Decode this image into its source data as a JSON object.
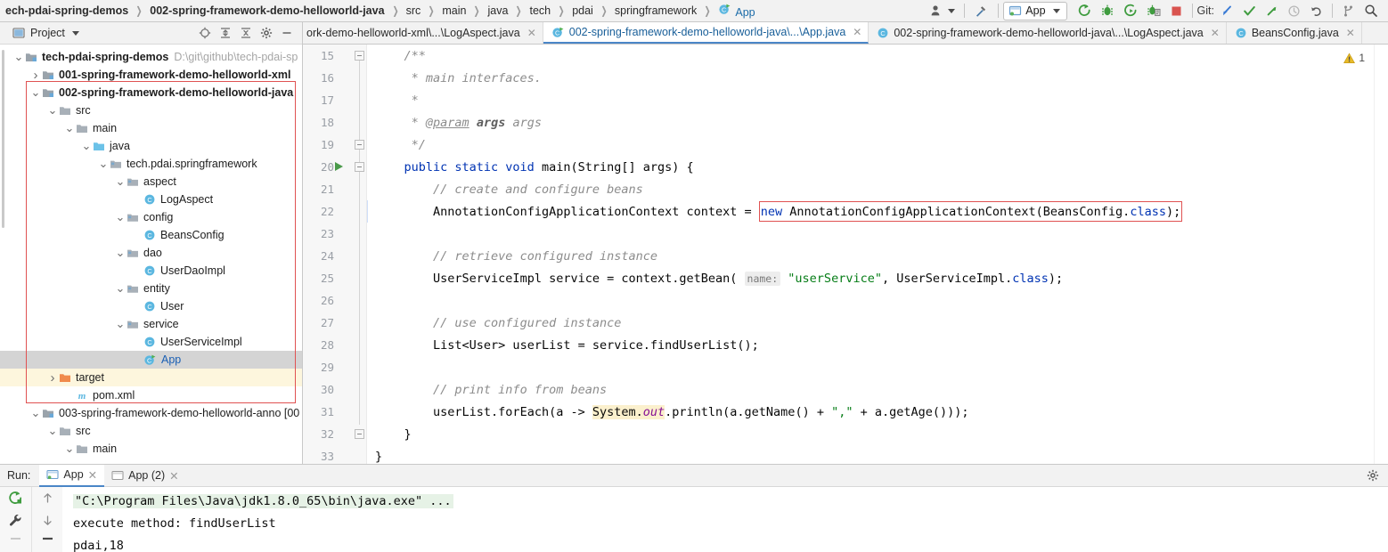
{
  "navbar": {
    "crumbs": [
      {
        "text": "ech-pdai-spring-demos",
        "bold": true,
        "icon": null
      },
      {
        "text": "002-spring-framework-demo-helloworld-java",
        "bold": true,
        "icon": null
      },
      {
        "text": "src",
        "bold": false,
        "icon": null
      },
      {
        "text": "main",
        "bold": false,
        "icon": null
      },
      {
        "text": "java",
        "bold": false,
        "icon": null
      },
      {
        "text": "tech",
        "bold": false,
        "icon": null
      },
      {
        "text": "pdai",
        "bold": false,
        "icon": null
      },
      {
        "text": "springframework",
        "bold": false,
        "icon": null
      },
      {
        "text": "App",
        "bold": false,
        "icon": "java-class-run-icon"
      }
    ]
  },
  "toolbar": {
    "items": [
      {
        "name": "user-settings-icon",
        "label": ""
      },
      {
        "name": "hammer-build-icon",
        "label": ""
      },
      {
        "name": "run-configuration-selector",
        "label": "App"
      },
      {
        "name": "run-icon",
        "label": ""
      },
      {
        "name": "debug-icon",
        "label": ""
      },
      {
        "name": "run-with-coverage-icon",
        "label": ""
      },
      {
        "name": "profile-icon",
        "label": ""
      },
      {
        "name": "stop-icon",
        "label": ""
      }
    ],
    "git_label": "Git:",
    "git_items": [
      {
        "name": "git-update-project-icon"
      },
      {
        "name": "git-commit-icon"
      },
      {
        "name": "git-push-icon"
      },
      {
        "name": "git-history-icon"
      },
      {
        "name": "git-rollback-icon"
      },
      {
        "name": "git-branches-icon"
      }
    ],
    "search_icon": "search-everywhere-icon"
  },
  "project_panel": {
    "title": "Project",
    "header_icons": [
      "locate-file-icon",
      "expand-all-icon",
      "collapse-all-icon",
      "settings-gear-icon",
      "hide-panel-icon"
    ],
    "tree": [
      {
        "indent": 0,
        "arrow": "v",
        "icon": "module-icon",
        "label": "tech-pdai-spring-demos",
        "bold": true,
        "path": "D:\\git\\github\\tech-pdai-sp",
        "state": "normal"
      },
      {
        "indent": 1,
        "arrow": ">",
        "icon": "module-icon",
        "label": "001-spring-framework-demo-helloworld-xml",
        "bold": true,
        "path": "",
        "state": "normal"
      },
      {
        "indent": 1,
        "arrow": "v",
        "icon": "module-icon",
        "label": "002-spring-framework-demo-helloworld-java",
        "bold": true,
        "path": "",
        "state": "normal"
      },
      {
        "indent": 2,
        "arrow": "v",
        "icon": "folder-icon",
        "label": "src",
        "bold": false,
        "path": "",
        "state": "normal"
      },
      {
        "indent": 3,
        "arrow": "v",
        "icon": "folder-icon",
        "label": "main",
        "bold": false,
        "path": "",
        "state": "normal"
      },
      {
        "indent": 4,
        "arrow": "v",
        "icon": "source-folder-icon",
        "label": "java",
        "bold": false,
        "path": "",
        "state": "normal"
      },
      {
        "indent": 5,
        "arrow": "v",
        "icon": "package-icon",
        "label": "tech.pdai.springframework",
        "bold": false,
        "path": "",
        "state": "normal"
      },
      {
        "indent": 6,
        "arrow": "v",
        "icon": "package-icon",
        "label": "aspect",
        "bold": false,
        "path": "",
        "state": "normal"
      },
      {
        "indent": 7,
        "arrow": "",
        "icon": "java-class-icon",
        "label": "LogAspect",
        "bold": false,
        "path": "",
        "state": "normal"
      },
      {
        "indent": 6,
        "arrow": "v",
        "icon": "package-icon",
        "label": "config",
        "bold": false,
        "path": "",
        "state": "normal"
      },
      {
        "indent": 7,
        "arrow": "",
        "icon": "java-class-icon",
        "label": "BeansConfig",
        "bold": false,
        "path": "",
        "state": "normal"
      },
      {
        "indent": 6,
        "arrow": "v",
        "icon": "package-icon",
        "label": "dao",
        "bold": false,
        "path": "",
        "state": "normal"
      },
      {
        "indent": 7,
        "arrow": "",
        "icon": "java-class-icon",
        "label": "UserDaoImpl",
        "bold": false,
        "path": "",
        "state": "normal"
      },
      {
        "indent": 6,
        "arrow": "v",
        "icon": "package-icon",
        "label": "entity",
        "bold": false,
        "path": "",
        "state": "normal"
      },
      {
        "indent": 7,
        "arrow": "",
        "icon": "java-class-icon",
        "label": "User",
        "bold": false,
        "path": "",
        "state": "normal"
      },
      {
        "indent": 6,
        "arrow": "v",
        "icon": "package-icon",
        "label": "service",
        "bold": false,
        "path": "",
        "state": "normal"
      },
      {
        "indent": 7,
        "arrow": "",
        "icon": "java-class-icon",
        "label": "UserServiceImpl",
        "bold": false,
        "path": "",
        "state": "normal"
      },
      {
        "indent": 7,
        "arrow": "",
        "icon": "java-class-run-icon",
        "label": "App",
        "bold": false,
        "path": "",
        "state": "selected"
      },
      {
        "indent": 2,
        "arrow": ">",
        "icon": "target-folder-icon",
        "label": "target",
        "bold": false,
        "path": "",
        "state": "target"
      },
      {
        "indent": 3,
        "arrow": "",
        "icon": "maven-pom-icon",
        "label": "pom.xml",
        "bold": false,
        "path": "",
        "state": "normal"
      },
      {
        "indent": 1,
        "arrow": "v",
        "icon": "module-icon",
        "label": "003-spring-framework-demo-helloworld-anno [00",
        "bold": false,
        "path": "",
        "state": "normal"
      },
      {
        "indent": 2,
        "arrow": "v",
        "icon": "folder-icon",
        "label": "src",
        "bold": false,
        "path": "",
        "state": "normal"
      },
      {
        "indent": 3,
        "arrow": "v",
        "icon": "folder-icon",
        "label": "main",
        "bold": false,
        "path": "",
        "state": "normal"
      }
    ]
  },
  "editor": {
    "tabs": [
      {
        "label": "ork-demo-helloworld-xml\\...\\LogAspect.java",
        "icon": null,
        "active": false,
        "closable": true
      },
      {
        "label": "002-spring-framework-demo-helloworld-java\\...\\App.java",
        "icon": "java-class-run-icon",
        "active": true,
        "closable": true
      },
      {
        "label": "002-spring-framework-demo-helloworld-java\\...\\LogAspect.java",
        "icon": "java-class-icon",
        "active": false,
        "closable": true
      },
      {
        "label": "BeansConfig.java",
        "icon": "java-class-icon",
        "active": false,
        "closable": true
      }
    ],
    "warning_count": "1",
    "warning_icon": "warning-triangle-icon",
    "first_line_number": 15,
    "lines": [
      {
        "n": 15,
        "segments": [
          {
            "t": "    ",
            "c": "plain"
          },
          {
            "t": "/**",
            "c": "cm"
          }
        ]
      },
      {
        "n": 16,
        "segments": [
          {
            "t": "     ",
            "c": "plain"
          },
          {
            "t": "* main interfaces.",
            "c": "cm"
          }
        ]
      },
      {
        "n": 17,
        "segments": [
          {
            "t": "     ",
            "c": "plain"
          },
          {
            "t": "*",
            "c": "cm"
          }
        ]
      },
      {
        "n": 18,
        "segments": [
          {
            "t": "     ",
            "c": "plain"
          },
          {
            "t": "* ",
            "c": "cm"
          },
          {
            "t": "@param",
            "c": "cmtag"
          },
          {
            "t": " ",
            "c": "cm"
          },
          {
            "t": "args",
            "c": "cmb"
          },
          {
            "t": " args",
            "c": "cm"
          }
        ]
      },
      {
        "n": 19,
        "segments": [
          {
            "t": "     ",
            "c": "plain"
          },
          {
            "t": "*/",
            "c": "cm"
          }
        ]
      },
      {
        "n": 20,
        "segments": [
          {
            "t": "    ",
            "c": "plain"
          },
          {
            "t": "public static void ",
            "c": "kw"
          },
          {
            "t": "main(String[] args) {",
            "c": "plain"
          }
        ]
      },
      {
        "n": 21,
        "segments": [
          {
            "t": "        ",
            "c": "plain"
          },
          {
            "t": "// create and configure beans",
            "c": "cm"
          }
        ]
      },
      {
        "n": 22,
        "segments": [
          {
            "t": "        ",
            "c": "plain"
          },
          {
            "t": "AnnotationConfigApplicationContext context = ",
            "c": "plain"
          },
          {
            "t": "BOX_START",
            "c": "boxstart"
          },
          {
            "t": "new ",
            "c": "kw"
          },
          {
            "t": "AnnotationConfigApplicationContext(BeansConfig.",
            "c": "plain"
          },
          {
            "t": "class",
            "c": "kw"
          },
          {
            "t": ");",
            "c": "plain"
          },
          {
            "t": "BOX_END",
            "c": "boxend"
          }
        ]
      },
      {
        "n": 23,
        "segments": []
      },
      {
        "n": 24,
        "segments": [
          {
            "t": "        ",
            "c": "plain"
          },
          {
            "t": "// retrieve configured instance",
            "c": "cm"
          }
        ]
      },
      {
        "n": 25,
        "segments": [
          {
            "t": "        ",
            "c": "plain"
          },
          {
            "t": "UserServiceImpl service = context.getBean( ",
            "c": "plain"
          },
          {
            "t": "name:",
            "c": "hintp"
          },
          {
            "t": " ",
            "c": "plain"
          },
          {
            "t": "\"userService\"",
            "c": "str"
          },
          {
            "t": ", UserServiceImpl.",
            "c": "plain"
          },
          {
            "t": "class",
            "c": "kw"
          },
          {
            "t": ");",
            "c": "plain"
          }
        ]
      },
      {
        "n": 26,
        "segments": []
      },
      {
        "n": 27,
        "segments": [
          {
            "t": "        ",
            "c": "plain"
          },
          {
            "t": "// use configured instance",
            "c": "cm"
          }
        ]
      },
      {
        "n": 28,
        "segments": [
          {
            "t": "        ",
            "c": "plain"
          },
          {
            "t": "List<User> userList = service.findUserList();",
            "c": "plain"
          }
        ]
      },
      {
        "n": 29,
        "segments": []
      },
      {
        "n": 30,
        "segments": [
          {
            "t": "        ",
            "c": "plain"
          },
          {
            "t": "// print info from beans",
            "c": "cm"
          }
        ]
      },
      {
        "n": 31,
        "segments": [
          {
            "t": "        ",
            "c": "plain"
          },
          {
            "t": "userList.forEach(a -> ",
            "c": "plain"
          },
          {
            "t": "System.",
            "c": "hl-plain"
          },
          {
            "t": "out",
            "c": "hl-static"
          },
          {
            "t": ".println(a.getName() + ",
            "c": "plain"
          },
          {
            "t": "\",\"",
            "c": "str"
          },
          {
            "t": " + a.getAge()));",
            "c": "plain"
          }
        ]
      },
      {
        "n": 32,
        "segments": [
          {
            "t": "    ",
            "c": "plain"
          },
          {
            "t": "}",
            "c": "plain"
          }
        ]
      },
      {
        "n": 33,
        "segments": [
          {
            "t": "",
            "c": "plain"
          },
          {
            "t": "}",
            "c": "plain"
          }
        ]
      }
    ]
  },
  "run_panel": {
    "run_label": "Run:",
    "tabs": [
      {
        "label": "App",
        "icon": "console-run-icon",
        "active": true
      },
      {
        "label": "App (2)",
        "icon": "console-icon",
        "active": false
      }
    ],
    "gear_icon": "settings-gear-icon",
    "side_icons": [
      "rerun-icon",
      "wrench-icon",
      "minus-icon",
      "up-arrow-icon",
      "down-arrow-icon",
      "soft-wrap-icon"
    ],
    "output": [
      {
        "text": "\"C:\\Program Files\\Java\\jdk1.8.0_65\\bin\\java.exe\" ...",
        "highlight": true
      },
      {
        "text": "execute method: findUserList",
        "highlight": false
      },
      {
        "text": "pdai,18",
        "highlight": false
      }
    ]
  },
  "colors": {
    "accent": "#4a86c7",
    "keyword": "#0033b3",
    "string": "#067d17",
    "comment": "#8c8c8c",
    "red_box": "#e05252",
    "selection": "#d4d4d4",
    "target_row": "#fdf6dd",
    "warning": "#e8bb28"
  }
}
